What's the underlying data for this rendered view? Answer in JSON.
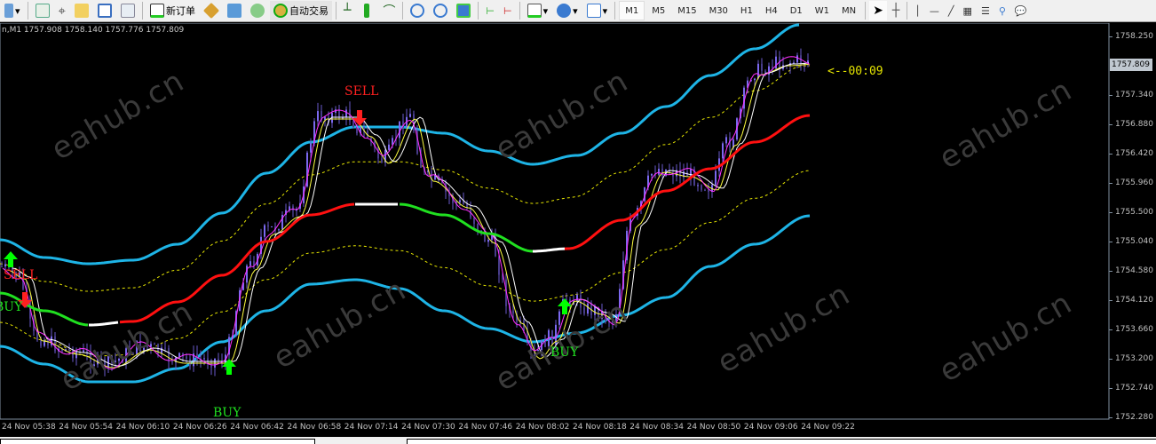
{
  "toolbar": {
    "new_order": "新订单",
    "auto_trading": "自动交易",
    "timeframes": [
      "M1",
      "M5",
      "M15",
      "M30",
      "H1",
      "H4",
      "D1",
      "W1",
      "MN"
    ],
    "active_timeframe": "M1"
  },
  "chart": {
    "info": "n,M1  1757.908 1758.140 1757.776 1757.809",
    "current_price": "1757.809",
    "price_labels": [
      "1758.250",
      "1757.340",
      "1756.880",
      "1756.420",
      "1755.960",
      "1755.500",
      "1755.040",
      "1754.580",
      "1754.120",
      "1753.660",
      "1753.200",
      "1752.740",
      "1752.280"
    ],
    "time_labels": [
      "24 Nov 05:38",
      "24 Nov 05:54",
      "24 Nov 06:10",
      "24 Nov 06:26",
      "24 Nov 06:42",
      "24 Nov 06:58",
      "24 Nov 07:14",
      "24 Nov 07:30",
      "24 Nov 07:46",
      "24 Nov 08:02",
      "24 Nov 08:18",
      "24 Nov 08:34",
      "24 Nov 08:50",
      "24 Nov 09:06",
      "24 Nov 09:22"
    ],
    "timer": "<--00:09",
    "signals": {
      "sell": "SELL",
      "buy": "BUY"
    },
    "watermark": "eahub.cn",
    "colors": {
      "band": "#1eb4e6",
      "mid_up": "#ff1010",
      "mid_down": "#20e020",
      "mid_flat": "#ffffff",
      "dashed": "#e6e600",
      "buy": "#00ff00",
      "sell": "#ff2020"
    }
  }
}
